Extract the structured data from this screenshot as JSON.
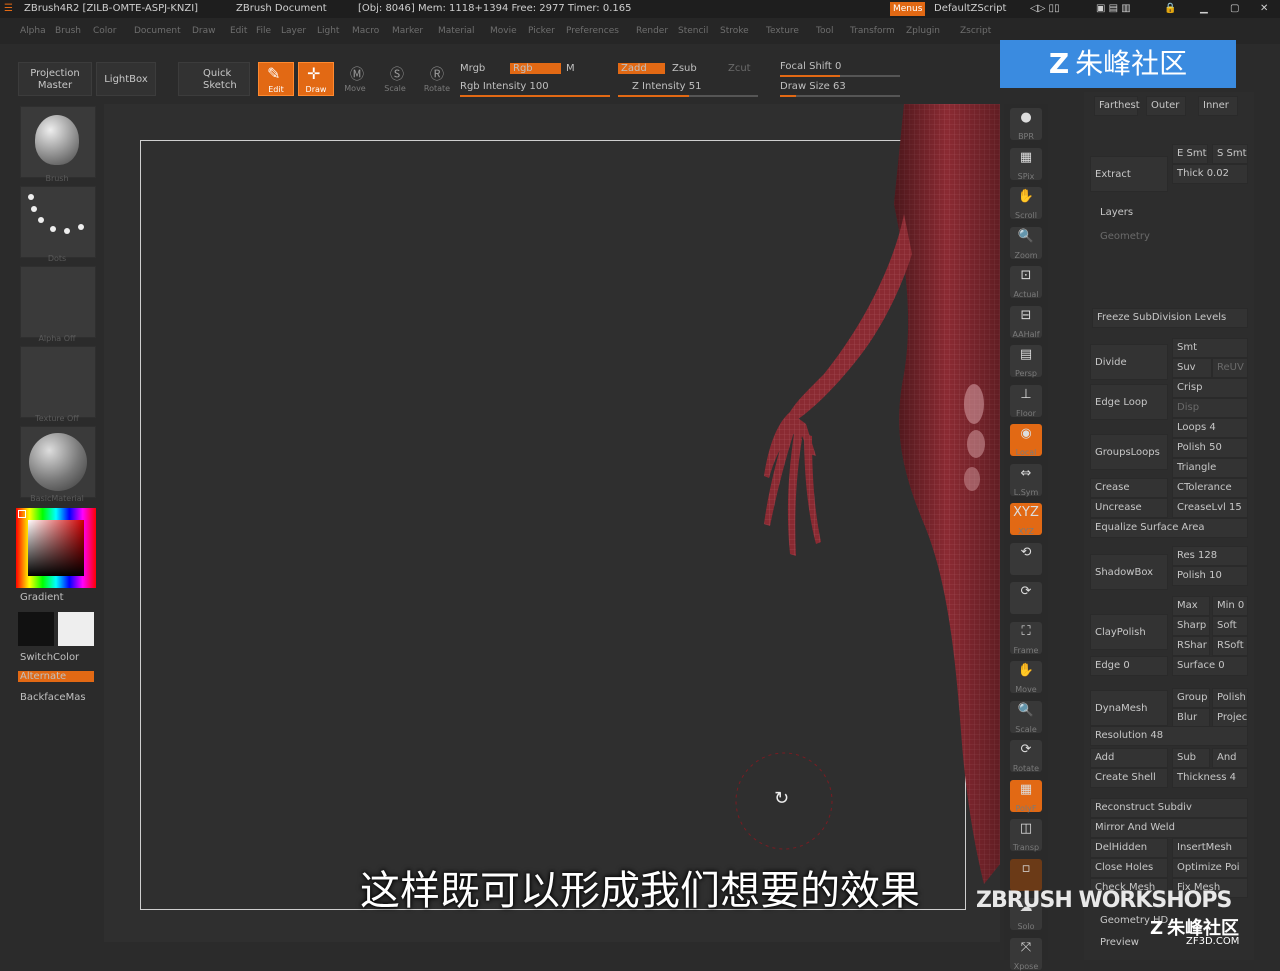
{
  "titlebar": {
    "app": "ZBrush4R2 [ZILB-OMTE-ASPJ-KNZI]",
    "doc": "ZBrush Document",
    "stats": "[Obj: 8046] Mem: 1118+1394 Free: 2977 Timer: 0.165",
    "menus": "Menus",
    "script": "DefaultZScript"
  },
  "menu": [
    "Alpha",
    "Brush",
    "Color",
    "Document",
    "Draw",
    "Edit",
    "File",
    "Layer",
    "Light",
    "Macro",
    "Marker",
    "Material",
    "Movie",
    "Picker",
    "Preferences",
    "Render",
    "Stencil",
    "Stroke",
    "Texture",
    "Tool",
    "Transform",
    "Zplugin",
    "Zscript"
  ],
  "toolbar": {
    "projection_master": "Projection Master",
    "lightbox": "LightBox",
    "quick_sketch": "Quick Sketch",
    "edit": "Edit",
    "draw": "Draw",
    "move": "Move",
    "scale": "Scale",
    "rotate": "Rotate",
    "mrgb": "Mrgb",
    "rgb": "Rgb",
    "m": "M",
    "zadd": "Zadd",
    "zsub": "Zsub",
    "zcut": "Zcut",
    "rgb_intensity": "Rgb Intensity 100",
    "z_intensity": "Z Intensity 51",
    "focal_shift": "Focal Shift 0",
    "draw_size": "Draw Size 63",
    "rgb_intensity_value": 100,
    "z_intensity_value": 51,
    "focal_shift_value": 0,
    "draw_size_value": 63
  },
  "left": {
    "brush_label": "Brush",
    "stroke_label": "Dots",
    "alpha_label": "Alpha Off",
    "texture_label": "Texture Off",
    "material_label": "BasicMaterial",
    "gradient": "Gradient",
    "switch_color": "SwitchColor",
    "alternate": "Alternate",
    "backface": "BackfaceMas"
  },
  "shelf": [
    "BPR",
    "SPix",
    "Scroll",
    "Zoom",
    "Actual",
    "AAHalf",
    "Persp",
    "Floor",
    "Local",
    "L.Sym",
    "XYZ",
    "",
    "",
    "Frame",
    "Move",
    "Scale",
    "Rotate",
    "PolyF",
    "Transp",
    "",
    "Solo",
    "Xpose"
  ],
  "panel": {
    "farthest": "Farthest",
    "outer": "Outer",
    "inner": "Inner",
    "extract": "Extract",
    "e_smt": "E Smt",
    "s_smt": "S Smt",
    "thick": "Thick 0.02",
    "layers": "Layers",
    "geometry": "Geometry",
    "freeze": "Freeze SubDivision Levels",
    "divide": "Divide",
    "smt": "Smt",
    "suv": "Suv",
    "reuv": "ReUV",
    "edge_loop": "Edge Loop",
    "crisp": "Crisp",
    "disp": "Disp",
    "loops": "Loops 4",
    "grouploops": "GroupsLoops",
    "polish": "Polish 50",
    "triangle": "Triangle",
    "crease": "Crease",
    "ctolerance": "CTolerance",
    "uncrease": "Uncrease",
    "creaselvl": "CreaseLvl 15",
    "equalize": "Equalize Surface Area",
    "shadowbox": "ShadowBox",
    "res": "Res 128",
    "polish10": "Polish 10",
    "claypolish": "ClayPolish",
    "max": "Max",
    "min": "Min 0",
    "sharp": "Sharp",
    "soft": "Soft",
    "rshar": "RShar",
    "rsoft": "RSoft",
    "edge": "Edge 0",
    "surface": "Surface 0",
    "dynamesh": "DynaMesh",
    "group": "Group",
    "polish_b": "Polish",
    "blur": "Blur",
    "project": "Projec",
    "resolution": "Resolution 48",
    "add": "Add",
    "sub": "Sub",
    "and": "And",
    "create_shell": "Create Shell",
    "thickness": "Thickness 4",
    "reconstruct": "Reconstruct Subdiv",
    "mirror_weld": "Mirror And Weld",
    "delhidden": "DelHidden",
    "insertmesh": "InsertMesh",
    "close_holes": "Close Holes",
    "optimize": "Optimize Poi",
    "check_mesh": "Check Mesh",
    "fix_mesh": "Fix Mesh",
    "geometry_hd": "Geometry HD",
    "preview": "Preview"
  },
  "subtitle": "这样既可以形成我们想要的效果",
  "watermark": {
    "top": "朱峰社区",
    "workshops": "ZBRUSH WORKSHOPS",
    "bottom": "朱峰社区",
    "url": "ZF3D.COM"
  },
  "colors": {
    "accent": "#e26914",
    "model": "#8a2a32",
    "watermark_blue": "#3a8be0"
  }
}
